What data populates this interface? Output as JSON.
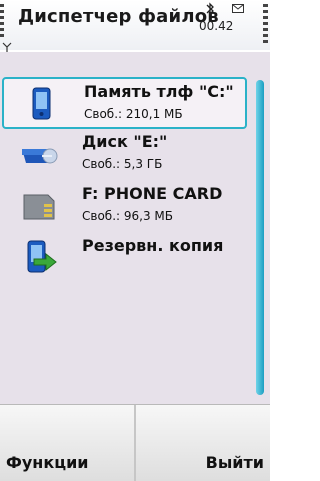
{
  "app": {
    "title": "Диспетчер файлов"
  },
  "status": {
    "time": "00.42"
  },
  "drives": [
    {
      "name": "Память тлф \"C:\"",
      "free": "Своб.: 210,1 МБ",
      "icon": "phone-memory-icon",
      "selected": true
    },
    {
      "name": "Диск \"E:\"",
      "free": "Своб.: 5,3 ГБ",
      "icon": "mass-storage-icon",
      "selected": false
    },
    {
      "name": "F: PHONE CARD",
      "free": "Своб.: 96,3 МБ",
      "icon": "memory-card-icon",
      "selected": false
    },
    {
      "name": "Резервн. копия",
      "free": "",
      "icon": "backup-icon",
      "selected": false
    }
  ],
  "softkeys": {
    "left": "Функции",
    "right": "Выйти"
  },
  "colors": {
    "selection": "#2ab2c8",
    "background": "#e7e1ea"
  }
}
